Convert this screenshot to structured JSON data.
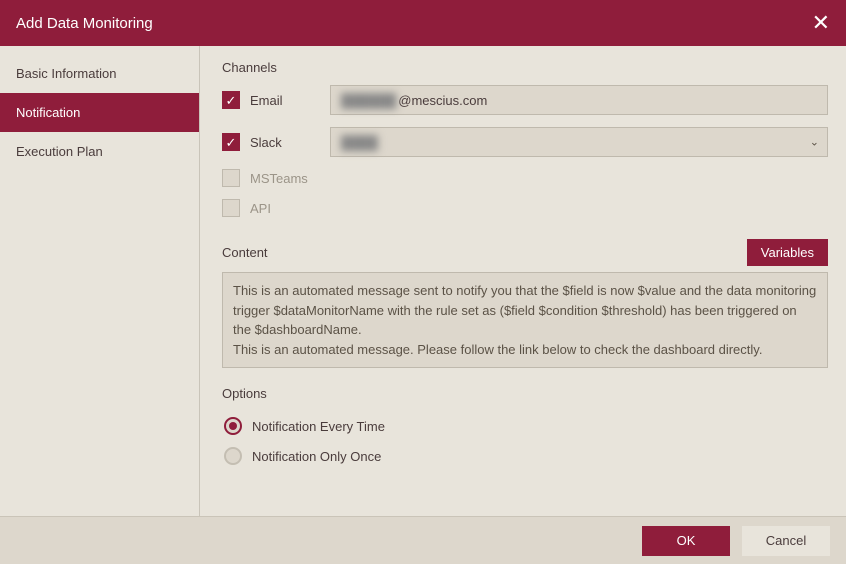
{
  "title": "Add Data Monitoring",
  "sidebar": {
    "items": [
      {
        "label": "Basic Information",
        "active": false
      },
      {
        "label": "Notification",
        "active": true
      },
      {
        "label": "Execution Plan",
        "active": false
      }
    ]
  },
  "channels": {
    "title": "Channels",
    "email": {
      "label": "Email",
      "checked": true,
      "value_suffix": "@mescius.com"
    },
    "slack": {
      "label": "Slack",
      "checked": true,
      "value_hidden": true
    },
    "msteams": {
      "label": "MSTeams",
      "checked": false
    },
    "api": {
      "label": "API",
      "checked": false
    }
  },
  "content": {
    "label": "Content",
    "variables_button": "Variables",
    "text_line1": "This is an automated message sent to notify you that the $field is now $value and the data monitoring trigger $dataMonitorName with the rule set as ($field $condition $threshold) has been triggered on the $dashboardName.",
    "text_line2": "This is an automated message. Please follow the link below to check the dashboard directly."
  },
  "options": {
    "title": "Options",
    "items": [
      {
        "label": "Notification Every Time",
        "selected": true
      },
      {
        "label": "Notification Only Once",
        "selected": false
      }
    ]
  },
  "footer": {
    "ok": "OK",
    "cancel": "Cancel"
  }
}
